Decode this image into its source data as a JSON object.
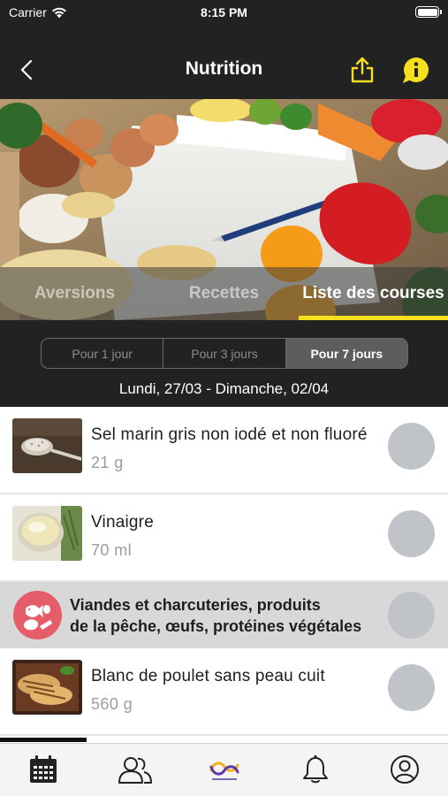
{
  "status_bar": {
    "carrier": "Carrier",
    "time": "8:15 PM"
  },
  "nav": {
    "title": "Nutrition",
    "back_icon": "chevron-left-icon",
    "share_icon": "share-icon",
    "info_icon": "info-icon"
  },
  "tabs": [
    {
      "label": "Aversions",
      "active": false
    },
    {
      "label": "Recettes",
      "active": false
    },
    {
      "label": "Liste des courses",
      "active": true
    }
  ],
  "period": {
    "options": [
      "Pour 1 jour",
      "Pour 3 jours",
      "Pour 7 jours"
    ],
    "selected": "Pour 7 jours",
    "date_range": "Lundi, 27/03 - Dimanche, 02/04"
  },
  "items": [
    {
      "name": "Sel marin gris non iodé et non fluoré",
      "quantity": "21 g",
      "image": "salt-spoon"
    },
    {
      "name": "Vinaigre",
      "quantity": "70 ml",
      "image": "vinegar-bowl"
    }
  ],
  "category": {
    "line1": "Viandes et charcuteries, produits",
    "line2": "de la pêche, œufs, protéines végétales",
    "icon": "meat-fish-egg-icon"
  },
  "items_after": [
    {
      "name": "Blanc de poulet sans peau cuit",
      "quantity": "560 g",
      "image": "grilled-chicken"
    }
  ],
  "tab_bar": {
    "items": [
      "calendar-icon",
      "people-icon",
      "app-logo-icon",
      "bell-icon",
      "profile-icon"
    ]
  },
  "colors": {
    "accent": "#f5e020",
    "header_bg": "#222222",
    "category_icon_bg": "#e65d6a",
    "check_circle": "#c0c3c8"
  }
}
